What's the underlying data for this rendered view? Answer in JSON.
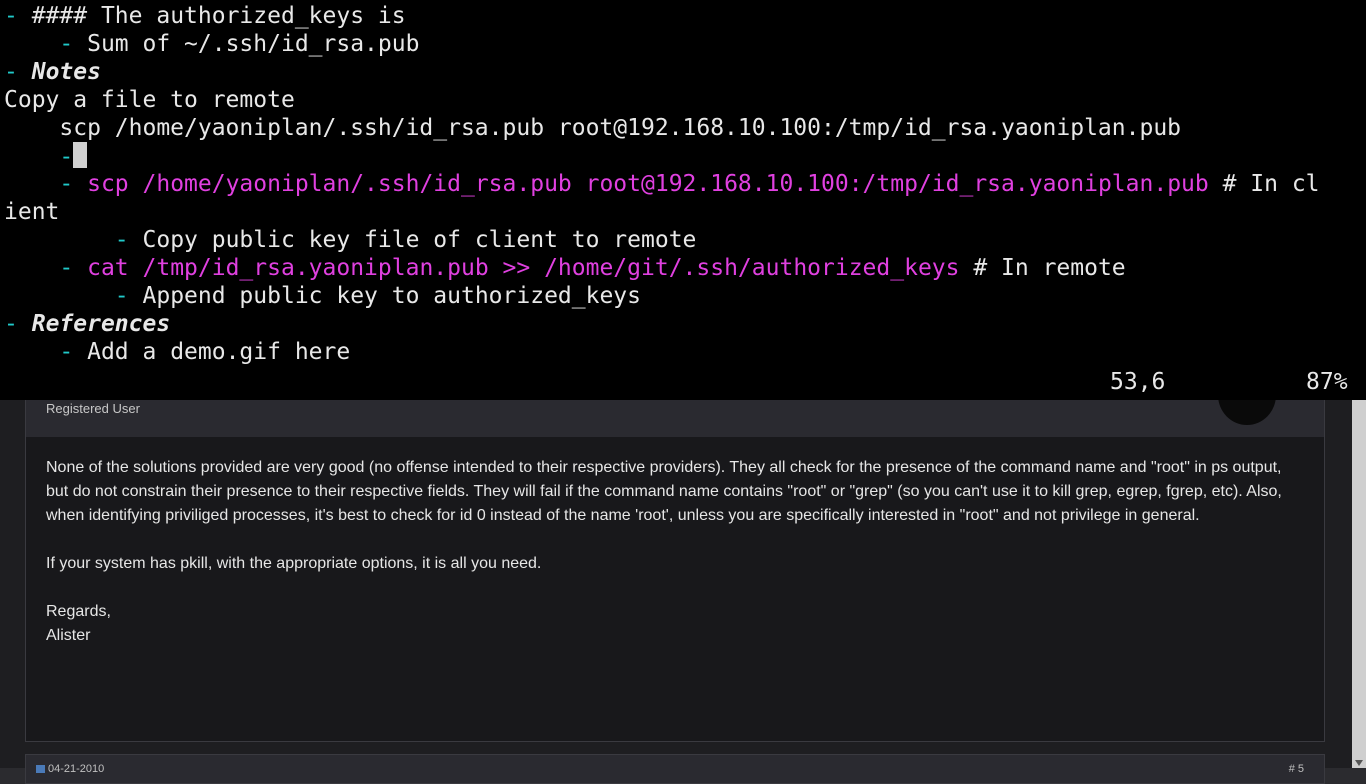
{
  "terminal": {
    "lines": {
      "l1": "#### The authorized_keys is",
      "l2": "Sum of ~/.ssh/id_rsa.pub",
      "l3": "Notes",
      "l4": "Copy a file to remote",
      "l5": "scp /home/yaoniplan/.ssh/id_rsa.pub root@192.168.10.100:/tmp/id_rsa.yaoniplan.pub",
      "l7_cmd": "scp /home/yaoniplan/.ssh/id_rsa.pub root@192.168.10.100:/tmp/id_rsa.yaoniplan.pub",
      "l7_comment": " # In cl",
      "l8": "ient",
      "l9": "Copy public key file of client to remote",
      "l10_cmd": "cat /tmp/id_rsa.yaoniplan.pub >> /home/git/.ssh/authorized_keys",
      "l10_comment": " # In remote",
      "l11": "Append public key to authorized_keys",
      "l12": "References",
      "l13": "Add a demo.gif here"
    },
    "dash": "-",
    "status": {
      "position": "53,6",
      "percent": "87%"
    },
    "colors": {
      "background": "#000000",
      "bullet": "#20c9c9",
      "command": "#e040e0",
      "text": "#e8e8e8"
    }
  },
  "forum": {
    "post1": {
      "role": "Registered User",
      "paragraphs": [
        "None of the solutions provided are very good (no offense intended to their respective providers). They all check for the presence of the command name and \"root\" in ps output, but do not constrain their presence to their respective fields. They will fail if the command name contains \"root\" or \"grep\" (so you can't use it to kill grep, egrep, fgrep, etc). Also, when identifying priviliged processes, it's best to check for id 0 instead of the name 'root', unless you are specifically interested in \"root\" and not privilege in general.",
        "If your system has pkill, with the appropriate options, it is all you need."
      ],
      "signoff_line1": "Regards,",
      "signoff_line2": "Alister"
    },
    "post2": {
      "date": "04-21-2010",
      "number": "# 5"
    }
  }
}
